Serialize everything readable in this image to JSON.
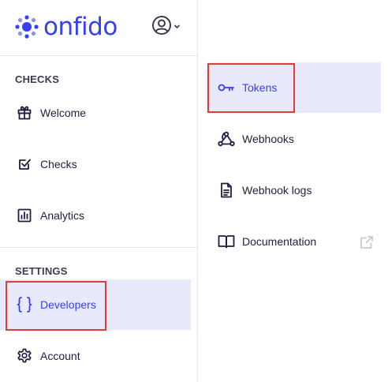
{
  "brand": {
    "name": "onfido",
    "color": "#353ff4"
  },
  "user_menu": {
    "icon": "user-circle-icon",
    "caret": "chevron-down-icon"
  },
  "sidebar": {
    "checks_heading": "CHECKS",
    "settings_heading": "SETTINGS",
    "items": [
      {
        "label": "Welcome",
        "icon": "gift-icon"
      },
      {
        "label": "Checks",
        "icon": "checkbox-icon"
      },
      {
        "label": "Analytics",
        "icon": "bar-chart-icon"
      },
      {
        "label": "Developers",
        "icon": "braces-icon",
        "active": true
      },
      {
        "label": "Account",
        "icon": "gear-icon"
      }
    ]
  },
  "submenu": {
    "items": [
      {
        "label": "Tokens",
        "icon": "key-icon",
        "active": true
      },
      {
        "label": "Webhooks",
        "icon": "webhook-icon"
      },
      {
        "label": "Webhook logs",
        "icon": "document-icon"
      },
      {
        "label": "Documentation",
        "icon": "book-icon",
        "external": "external-link-icon"
      }
    ]
  },
  "colors": {
    "accent": "#353ff4",
    "active_bg": "#e9e9fc",
    "highlight": "#e53935",
    "text": "#1c1f40"
  }
}
